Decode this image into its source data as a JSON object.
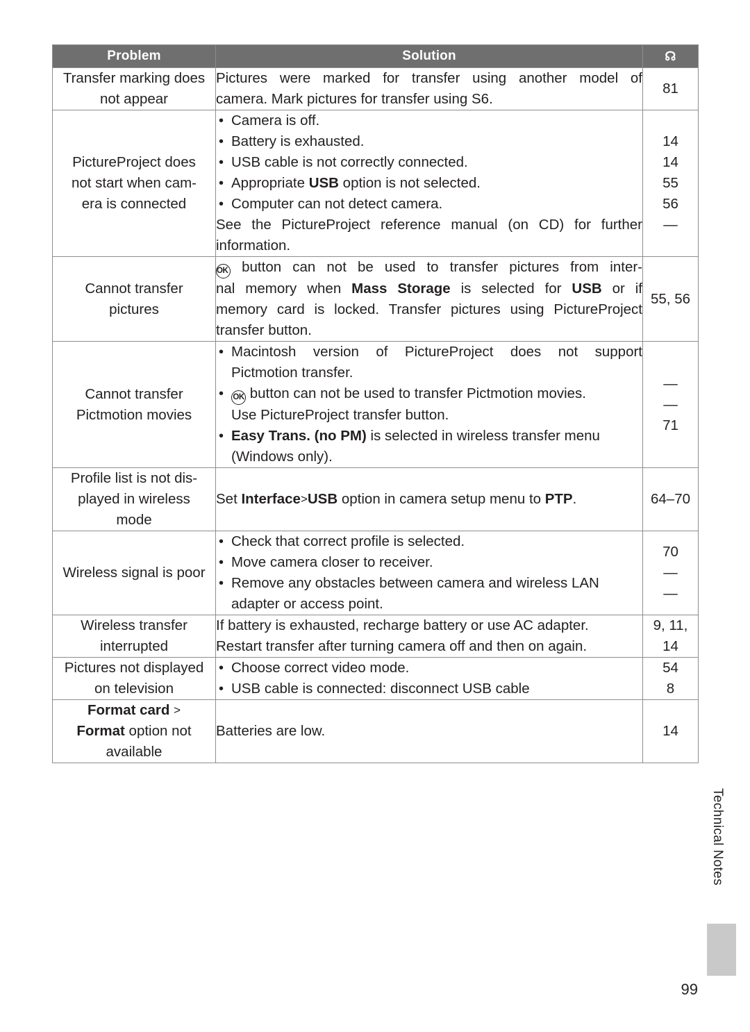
{
  "table": {
    "headers": {
      "problem": "Problem",
      "solution": "Solution",
      "page": "page-ref-icon"
    },
    "rows": [
      {
        "problem": "Transfer marking does not appear",
        "solution_lines": [
          "Pictures were marked for transfer using another model of",
          "camera. Mark pictures for transfer using S6."
        ],
        "pages": [
          "81"
        ]
      },
      {
        "problem": "PictureProject does not start when cam-era is connected",
        "solution_lines": [
          "Camera is off.",
          "Battery is exhausted.",
          "USB cable is not correctly connected.",
          "Appropriate USB option is not selected.",
          "Computer can not detect camera.",
          "See the PictureProject reference manual (on CD) for further",
          "information."
        ],
        "pages": [
          "14",
          "14",
          "55",
          "56",
          "—"
        ]
      },
      {
        "problem": "Cannot transfer pictures",
        "solution_lines": [
          "button can not be used to transfer pictures from inter-",
          "nal memory when Mass Storage is selected for USB or if",
          "memory card is locked. Transfer pictures using PictureProject",
          "transfer button."
        ],
        "pages": [
          "55, 56"
        ]
      },
      {
        "problem": "Cannot transfer Pictmotion movies",
        "solution_lines": [
          "Macintosh version of PictureProject does not support",
          "Pictmotion transfer.",
          "button can not be used to transfer Pictmotion movies.",
          "Use PictureProject transfer button.",
          "Easy Trans. (no PM) is selected in wireless transfer menu",
          "(Windows only)."
        ],
        "pages": [
          "—",
          "—",
          "71"
        ]
      },
      {
        "problem": "Profile list is not dis-played in wireless mode",
        "solution_lines": [
          "Set Interface > USB option in camera setup menu to PTP."
        ],
        "pages": [
          "64–70"
        ]
      },
      {
        "problem": "Wireless signal is poor",
        "solution_lines": [
          "Check that correct profile is selected.",
          "Move camera closer to receiver.",
          "Remove any obstacles between camera and wireless LAN",
          "adapter or access point."
        ],
        "pages": [
          "70",
          "—",
          "—"
        ]
      },
      {
        "problem": "Wireless transfer interrupted",
        "solution_lines": [
          "If battery is exhausted, recharge battery or use AC adapter.",
          "Restart transfer after turning camera off and then on again."
        ],
        "pages": [
          "9, 11,",
          "14"
        ]
      },
      {
        "problem": "Pictures not displayed on television",
        "solution_lines": [
          "Choose correct video mode.",
          "USB cable is connected: disconnect USB cable"
        ],
        "pages": [
          "54",
          "8"
        ]
      },
      {
        "problem": "Format card > Format option not available",
        "solution_lines": [
          "Batteries are low."
        ],
        "pages": [
          "14"
        ]
      }
    ]
  },
  "side_tab": {
    "label": "Technical Notes"
  },
  "page_number": "99",
  "labels": {
    "ok_button": "OK",
    "arrow": "›"
  }
}
